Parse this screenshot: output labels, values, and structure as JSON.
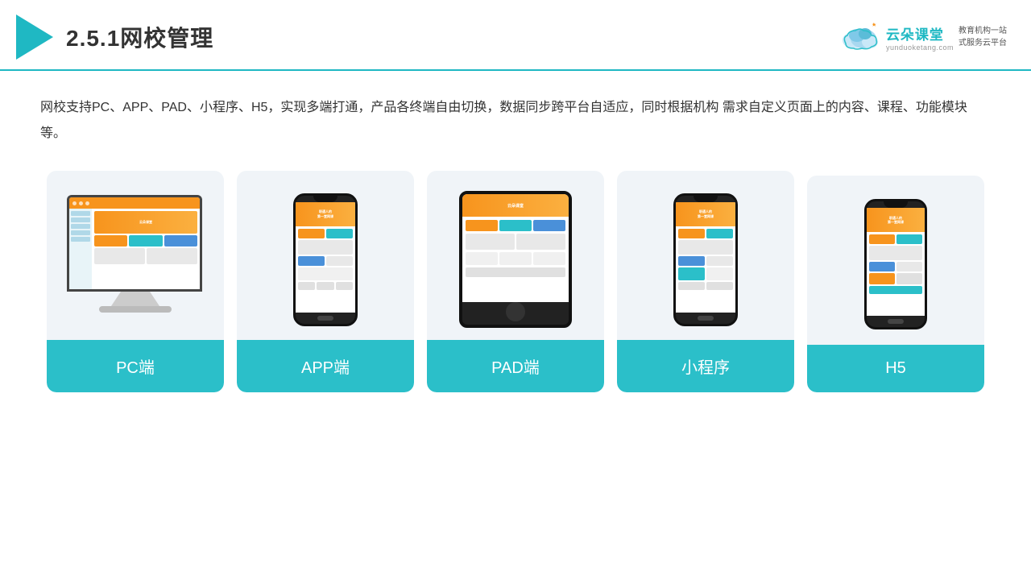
{
  "header": {
    "title": "2.5.1网校管理",
    "brand_name": "云朵课堂",
    "brand_url": "yunduoketang.com",
    "brand_slogan": "教育机构一站\n式服务云平台"
  },
  "description": "网校支持PC、APP、PAD、小程序、H5，实现多端打通，产品各终端自由切换，数据同步跨平台自适应，同时根据机构\n需求自定义页面上的内容、课程、功能模块等。",
  "cards": [
    {
      "label": "PC端"
    },
    {
      "label": "APP端"
    },
    {
      "label": "PAD端"
    },
    {
      "label": "小程序"
    },
    {
      "label": "H5"
    }
  ],
  "colors": {
    "accent": "#2bbfc9",
    "orange": "#f7941d",
    "dark": "#222222",
    "light_bg": "#f0f4f8"
  }
}
